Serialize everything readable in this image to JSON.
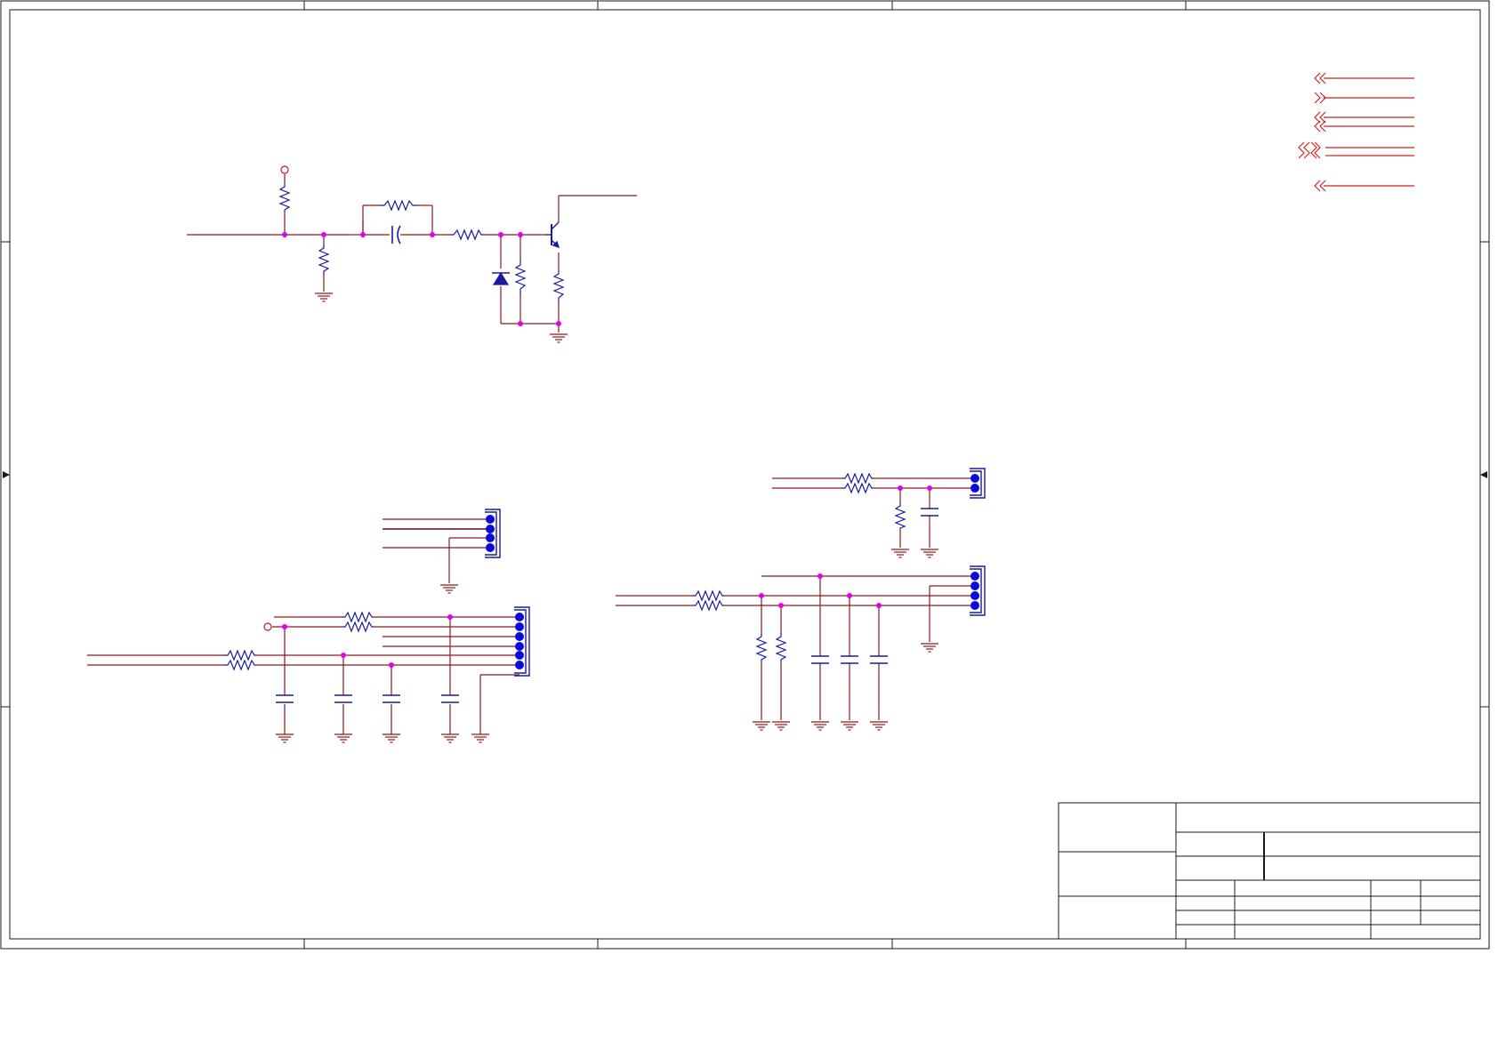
{
  "page": {
    "background": "#ffffff"
  },
  "colors": {
    "frame": "#1a1a1a",
    "wire": "#8b1a1a",
    "wire_dark": "#1a1a8b",
    "component": "#1a1a9c",
    "junction": "#e600e6",
    "pin_dot": "#0a0adc",
    "power_symbol": "#b22222",
    "port_arrow": "#cc2222"
  },
  "icons": {
    "ground": "ground-icon",
    "resistor": "resistor-icon",
    "capacitor": "capacitor-icon",
    "diode": "zener-diode-icon",
    "transistor": "npn-transistor-icon",
    "connector": "connector-header-icon",
    "power_port": "power-port-icon",
    "off_sheet_port": "off-sheet-arrow-icon"
  },
  "title_block": {
    "title": "",
    "size": "",
    "number": "",
    "revision": "",
    "date": "",
    "file": "",
    "sheet": "",
    "drawn_by": ""
  }
}
